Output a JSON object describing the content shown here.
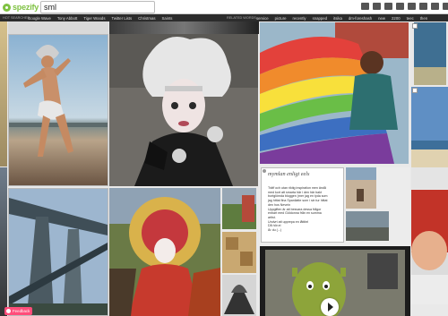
{
  "header": {
    "logo_text": "spezify",
    "search_value": "sml"
  },
  "search_bar": {
    "hot_label": "HOT SEARCHES",
    "hot_searches": [
      "Google Wave",
      "Tony Abbott",
      "Tiger Woods",
      "Twitter Lists",
      "Christmas",
      "Saints"
    ],
    "related_label": "RELATED WORDS",
    "related_words": [
      "service",
      "picture",
      "recently",
      "snapped",
      "itsika",
      "dm-foreshash",
      "new",
      "2200",
      "teec",
      "then"
    ]
  },
  "blog_card": {
    "title": "mymlan enligt eels",
    "lines": [
      "Träff och utan riktig inspiration men ändå",
      "med kort att smarta här i den här bakt",
      "bortglömda bloggen (mer jag en tyda som",
      "jag hittat fina Spanilatte som i sin tur hittat",
      "den hos Nevein",
      "Uppgiften är att besvara dessa frågor",
      "enbart med Göldonna från en summa",
      "artist.",
      "Undvrt att upprepa en låttitel",
      "Då hör.ei",
      "Är du (...)"
    ]
  },
  "feedback_label": "Feedback",
  "colors": {
    "brand": "#7fc242",
    "feedback": "#ff4d7a",
    "search_bar_bg": "#2c2c2c"
  }
}
